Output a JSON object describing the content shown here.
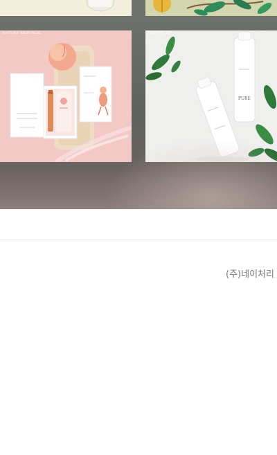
{
  "gallery": {
    "items": [
      {
        "brand": "",
        "description": "top crop product tile left"
      },
      {
        "brand": "",
        "description": "top crop product tile right"
      },
      {
        "brand": "NATURE REPUBLIC"
      },
      {
        "brand": "NATURE RE"
      }
    ],
    "products": {
      "peach_box_title": "",
      "pure_bottle_label": "PURE"
    }
  },
  "footer": {
    "company_name": "(주)네이처리"
  },
  "colors": {
    "gallery_bg": "#5e625d",
    "pink_tile": "#f1c8c4",
    "white_tile": "#f1f1f0",
    "footer_text": "#777777",
    "divider": "#e3e3e3"
  }
}
